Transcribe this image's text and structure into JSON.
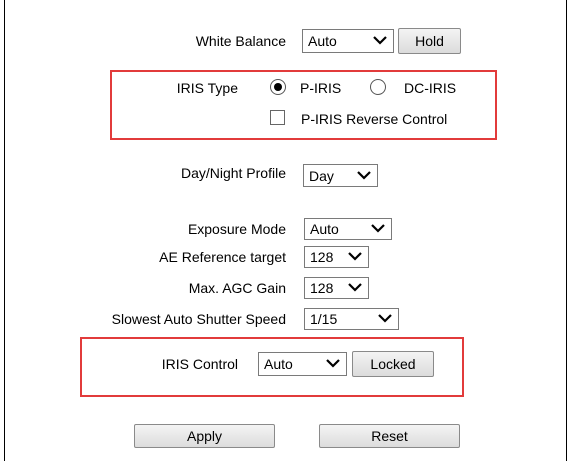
{
  "white_balance": {
    "label": "White Balance",
    "value": "Auto",
    "hold_label": "Hold"
  },
  "iris_type": {
    "label": "IRIS Type",
    "options": [
      {
        "label": "P-IRIS",
        "selected": true
      },
      {
        "label": "DC-IRIS",
        "selected": false
      }
    ],
    "reverse_label": "P-IRIS Reverse Control",
    "reverse_checked": false
  },
  "day_night": {
    "label": "Day/Night Profile",
    "value": "Day"
  },
  "exposure_mode": {
    "label": "Exposure Mode",
    "value": "Auto"
  },
  "ae_reference": {
    "label": "AE Reference target",
    "value": "128"
  },
  "max_agc": {
    "label": "Max. AGC Gain",
    "value": "128"
  },
  "shutter": {
    "label": "Slowest Auto Shutter Speed",
    "value": "1/15"
  },
  "iris_control": {
    "label": "IRIS Control",
    "value": "Auto",
    "locked_label": "Locked"
  },
  "actions": {
    "apply_label": "Apply",
    "reset_label": "Reset"
  },
  "colors": {
    "highlight": "#e23b3b"
  }
}
